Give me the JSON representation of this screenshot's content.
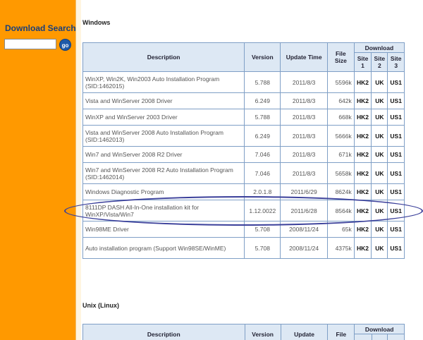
{
  "sidebar": {
    "search_title": "Download Search",
    "search_placeholder": "",
    "go_label": "go"
  },
  "sections": {
    "windows_title": "Windows",
    "unix_title": "Unix (Linux)"
  },
  "table_headers": {
    "description": "Description",
    "version": "Version",
    "update_time": "Update Time",
    "file_size": "File Size",
    "download": "Download",
    "site1": "Site 1",
    "site2": "Site 2",
    "site3": "Site 3"
  },
  "windows_rows": [
    {
      "desc": "WinXP, Win2K, Win2003 Auto Installation Program (SID:1462015)",
      "version": "5.788",
      "date": "2011/8/3",
      "size": "5596k",
      "s1": "HK2",
      "s2": "UK",
      "s3": "US1"
    },
    {
      "desc": "Vista and WinServer 2008 Driver",
      "version": "6.249",
      "date": "2011/8/3",
      "size": "642k",
      "s1": "HK2",
      "s2": "UK",
      "s3": "US1"
    },
    {
      "desc": "WinXP and WinServer 2003 Driver",
      "version": "5.788",
      "date": "2011/8/3",
      "size": "668k",
      "s1": "HK2",
      "s2": "UK",
      "s3": "US1"
    },
    {
      "desc": "Vista and WinServer 2008 Auto Installation Program (SID:1462013)",
      "version": "6.249",
      "date": "2011/8/3",
      "size": "5666k",
      "s1": "HK2",
      "s2": "UK",
      "s3": "US1"
    },
    {
      "desc": "Win7 and WinServer 2008 R2 Driver",
      "version": "7.046",
      "date": "2011/8/3",
      "size": "671k",
      "s1": "HK2",
      "s2": "UK",
      "s3": "US1"
    },
    {
      "desc": "Win7 and WinServer 2008 R2 Auto Installation Program (SID:1462014)",
      "version": "7.046",
      "date": "2011/8/3",
      "size": "5658k",
      "s1": "HK2",
      "s2": "UK",
      "s3": "US1"
    },
    {
      "desc": "Windows Diagnostic Program",
      "version": "2.0.1.8",
      "date": "2011/6/29",
      "size": "8624k",
      "s1": "HK2",
      "s2": "UK",
      "s3": "US1"
    },
    {
      "desc": "8111DP DASH All-In-One installation kit for WinXP/Vista/Win7",
      "version": "1.12.0022",
      "date": "2011/6/28",
      "size": "8564k",
      "s1": "HK2",
      "s2": "UK",
      "s3": "US1"
    },
    {
      "desc": "Win98ME Driver",
      "version": "5.708",
      "date": "2008/11/24",
      "size": "65k",
      "s1": "HK2",
      "s2": "UK",
      "s3": "US1"
    },
    {
      "desc": "Auto installation program (Support Win98SE/WinME)",
      "version": "5.708",
      "date": "2008/11/24",
      "size": "4375k",
      "s1": "HK2",
      "s2": "UK",
      "s3": "US1"
    }
  ],
  "unix_headers": {
    "description": "Description",
    "version": "Version",
    "update": "Update",
    "file": "File",
    "download": "Download"
  },
  "colors": {
    "sidebar": "#ff9900",
    "header_bg": "#dde8f4",
    "border": "#7f9fc6",
    "highlight_ellipse": "#3a3f9a"
  }
}
